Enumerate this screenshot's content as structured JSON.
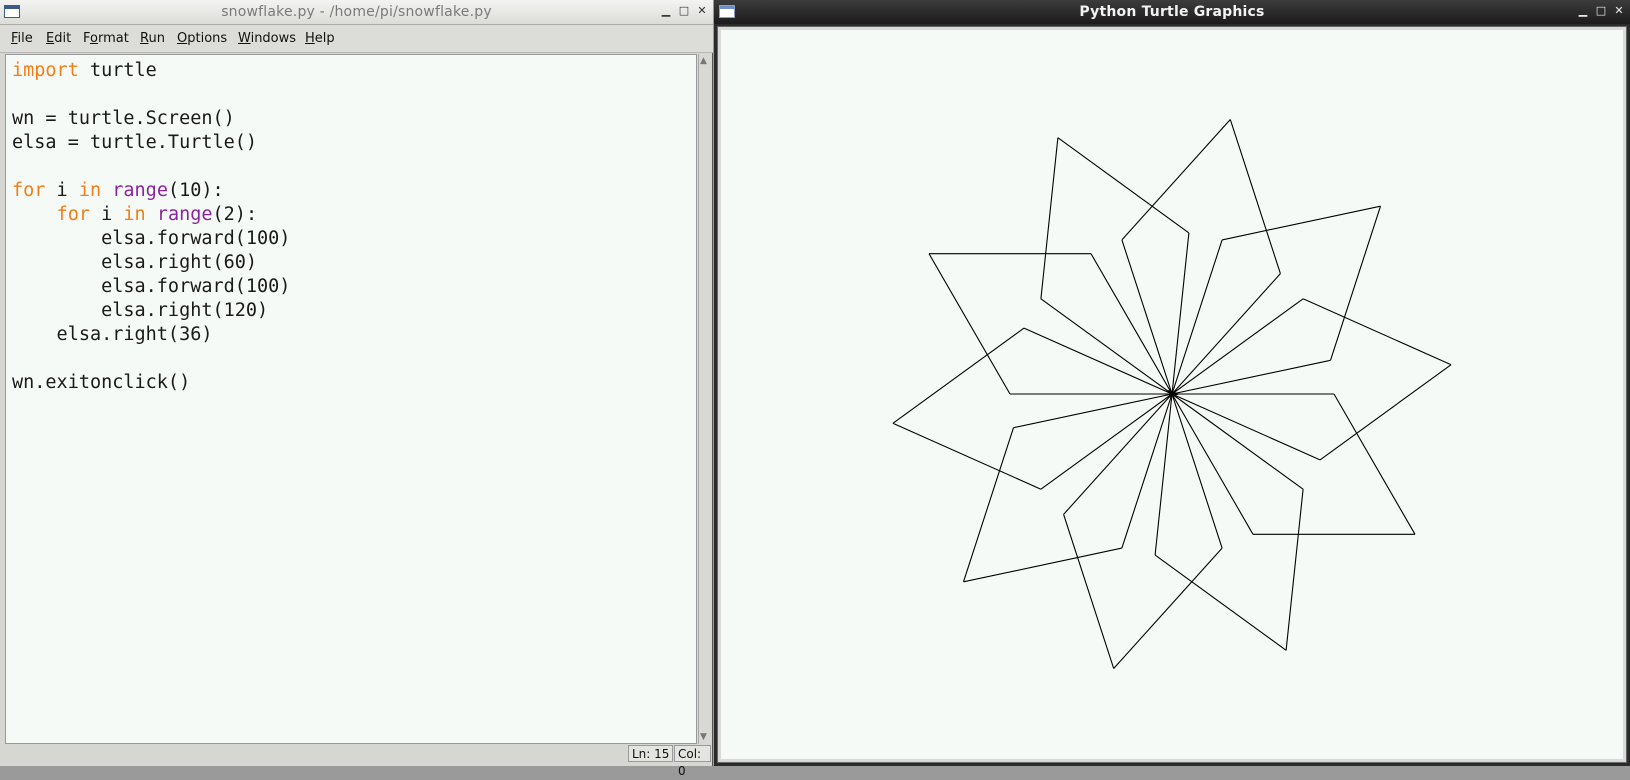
{
  "editor": {
    "title": "snowflake.py - /home/pi/snowflake.py",
    "menu": [
      {
        "key": "F",
        "rest": "ile"
      },
      {
        "key": "E",
        "rest": "dit"
      },
      {
        "key": "",
        "pre": "F",
        "ukey": "o",
        "rest": "rmat"
      },
      {
        "key": "R",
        "rest": "un"
      },
      {
        "key": "O",
        "rest": "ptions"
      },
      {
        "key": "W",
        "rest": "indows"
      },
      {
        "key": "H",
        "rest": "elp"
      }
    ],
    "menu_labels": [
      "File",
      "Edit",
      "Format",
      "Run",
      "Options",
      "Windows",
      "Help"
    ],
    "code": {
      "l1_kw": "import",
      "l1_rest": " turtle",
      "l3": "wn = turtle.Screen()",
      "l4": "elsa = turtle.Turtle()",
      "l6_kw1": "for",
      "l6_a": " i ",
      "l6_kw2": "in",
      "l6_sp": " ",
      "l6_bi": "range",
      "l6_rest": "(10):",
      "l7_ind": "    ",
      "l7_kw1": "for",
      "l7_a": " i ",
      "l7_kw2": "in",
      "l7_sp": " ",
      "l7_bi": "range",
      "l7_rest": "(2):",
      "l8": "        elsa.forward(100)",
      "l9": "        elsa.right(60)",
      "l10": "        elsa.forward(100)",
      "l11": "        elsa.right(120)",
      "l12": "    elsa.right(36)",
      "l14": "wn.exitonclick()"
    },
    "status": {
      "line": "Ln: 15",
      "col": "Col: 0"
    }
  },
  "turtle_window": {
    "title": "Python Turtle Graphics",
    "drawing": {
      "outer_loops": 10,
      "inner_loops": 2,
      "forward": 100,
      "turn_a": 60,
      "turn_b": 120,
      "outer_turn": 36,
      "pen_color": "#000000"
    }
  },
  "colors": {
    "keyword": "#ef7f1a",
    "builtin": "#8a23a0",
    "canvas_bg": "#f6faf6"
  }
}
